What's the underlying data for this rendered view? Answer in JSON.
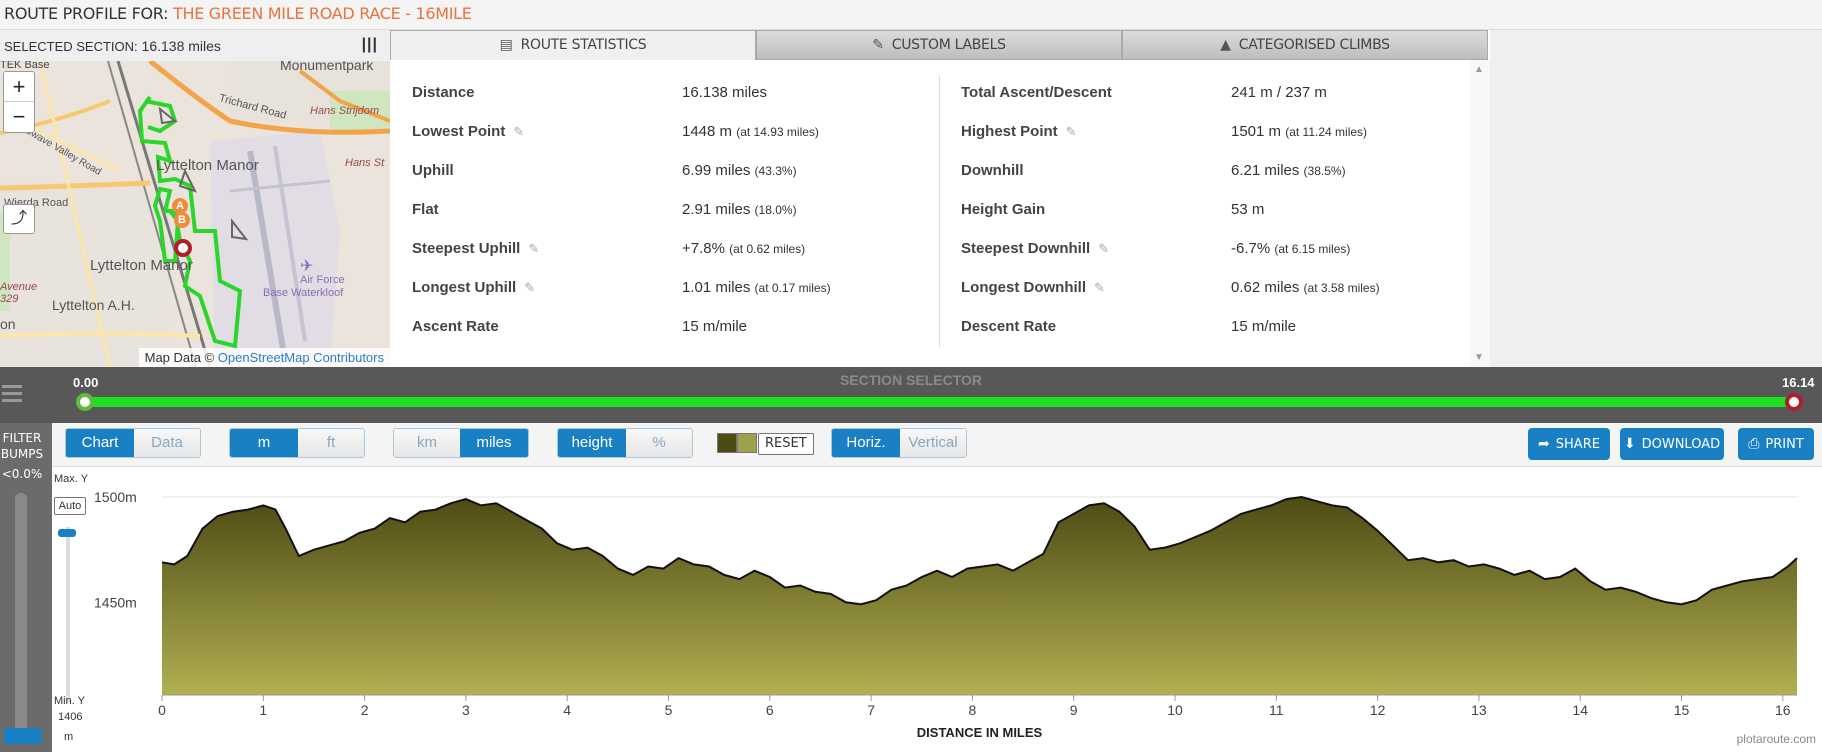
{
  "title": {
    "label": "ROUTE PROFILE FOR:",
    "route_name": "THE GREEN MILE ROAD RACE - 16MILE"
  },
  "map": {
    "selected_section_label": "SELECTED SECTION:",
    "selected_section_value": "16.138 miles",
    "labels": [
      "TEK Base",
      "Monumentpark",
      "Trichard Road",
      "Hans Strijdom",
      "Hans St",
      "Lyttelton Manor",
      "Wierda Road",
      "Lyttelton Manor",
      "Air Force",
      "Base Waterkloof",
      "Lyttelton A.H.",
      "Avenue",
      "329",
      "on",
      "Swave Valley Road"
    ],
    "zoom_in": "+",
    "zoom_out": "−",
    "markers": [
      "A",
      "B"
    ],
    "attribution_prefix": "Map Data ©",
    "attribution_link": "OpenStreetMap Contributors"
  },
  "tabs": [
    {
      "label": "ROUTE STATISTICS",
      "icon": "list-icon",
      "active": true
    },
    {
      "label": "CUSTOM LABELS",
      "icon": "pencil-icon",
      "active": false
    },
    {
      "label": "CATEGORISED CLIMBS",
      "icon": "mountain-icon",
      "active": false
    }
  ],
  "stats": {
    "left": [
      {
        "name": "Distance",
        "value": "16.138 miles",
        "extra": "",
        "editable": false
      },
      {
        "name": "Lowest Point",
        "value": "1448 m",
        "extra": "(at 14.93 miles)",
        "editable": true
      },
      {
        "name": "Uphill",
        "value": "6.99 miles",
        "extra": "(43.3%)",
        "editable": false
      },
      {
        "name": "Flat",
        "value": "2.91 miles",
        "extra": "(18.0%)",
        "editable": false
      },
      {
        "name": "Steepest Uphill",
        "value": "+7.8%",
        "extra": "(at 0.62 miles)",
        "editable": true
      },
      {
        "name": "Longest Uphill",
        "value": "1.01 miles",
        "extra": "(at 0.17 miles)",
        "editable": true
      },
      {
        "name": "Ascent Rate",
        "value": "15 m/mile",
        "extra": "",
        "editable": false
      }
    ],
    "right": [
      {
        "name": "Total Ascent/Descent",
        "value": "241 m / 237 m",
        "extra": "",
        "editable": false
      },
      {
        "name": "Highest Point",
        "value": "1501 m",
        "extra": "(at 11.24 miles)",
        "editable": true
      },
      {
        "name": "Downhill",
        "value": "6.21 miles",
        "extra": "(38.5%)",
        "editable": false
      },
      {
        "name": "Height Gain",
        "value": "53 m",
        "extra": "",
        "editable": false
      },
      {
        "name": "Steepest Downhill",
        "value": "-6.7%",
        "extra": "(at 6.15 miles)",
        "editable": true
      },
      {
        "name": "Longest Downhill",
        "value": "0.62 miles",
        "extra": "(at 3.58 miles)",
        "editable": true
      },
      {
        "name": "Descent Rate",
        "value": "15 m/mile",
        "extra": "",
        "editable": false
      }
    ]
  },
  "selector": {
    "caption": "SECTION SELECTOR",
    "start": "0.00",
    "end": "16.14",
    "track_color": "#1fe01f"
  },
  "filter": {
    "line1": "FILTER",
    "line2": "BUMPS",
    "value": "<0.0%"
  },
  "controls": {
    "chart_data_toggle": [
      "Chart",
      "Data"
    ],
    "units_height": [
      "m",
      "ft"
    ],
    "units_distance": [
      "km",
      "miles"
    ],
    "mode": [
      "height",
      "%"
    ],
    "reset": "RESET",
    "orientation": [
      "Horiz.",
      "Vertical"
    ],
    "share": "SHARE",
    "download": "DOWNLOAD",
    "print": "PRINT",
    "accent_color": "#1a80c4"
  },
  "yaxis_controls": {
    "max_label": "Max. Y",
    "auto": "Auto",
    "min_label": "Min. Y",
    "min_value": "1406",
    "min_unit": "m"
  },
  "credit": "plotaroute.com",
  "chart_data": {
    "type": "area",
    "title": "",
    "xlabel": "DISTANCE IN MILES",
    "ylabel": "",
    "xlim": [
      0,
      16.14
    ],
    "ylim": [
      1406,
      1500
    ],
    "x_ticks": [
      0,
      1,
      2,
      3,
      4,
      5,
      6,
      7,
      8,
      9,
      10,
      11,
      12,
      13,
      14,
      15,
      16
    ],
    "y_ticks": [
      {
        "value": 1500,
        "label": "1500m"
      },
      {
        "value": 1450,
        "label": "1450m"
      }
    ],
    "fill_top": "#4e4a14",
    "fill_bottom": "#b1b052",
    "series": [
      {
        "x": [
          0,
          0.12,
          0.25,
          0.4,
          0.55,
          0.7,
          0.85,
          1.0,
          1.12,
          1.22,
          1.35,
          1.5,
          1.65,
          1.8,
          1.95,
          2.1,
          2.25,
          2.4,
          2.55,
          2.7,
          2.85,
          3.0,
          3.15,
          3.3,
          3.45,
          3.6,
          3.75,
          3.9,
          4.05,
          4.2,
          4.35,
          4.5,
          4.65,
          4.8,
          4.95,
          5.1,
          5.25,
          5.4,
          5.55,
          5.7,
          5.85,
          6.0,
          6.15,
          6.3,
          6.45,
          6.6,
          6.75,
          6.9,
          7.05,
          7.2,
          7.35,
          7.5,
          7.65,
          7.8,
          7.95,
          8.1,
          8.25,
          8.4,
          8.55,
          8.7,
          8.85,
          9.0,
          9.15,
          9.3,
          9.45,
          9.6,
          9.75,
          9.9,
          10.05,
          10.2,
          10.35,
          10.5,
          10.65,
          10.8,
          10.95,
          11.1,
          11.25,
          11.4,
          11.55,
          11.7,
          11.85,
          12.0,
          12.15,
          12.3,
          12.45,
          12.6,
          12.75,
          12.9,
          13.05,
          13.2,
          13.35,
          13.5,
          13.65,
          13.8,
          13.95,
          14.1,
          14.25,
          14.4,
          14.55,
          14.7,
          14.85,
          15.0,
          15.15,
          15.3,
          15.45,
          15.6,
          15.75,
          15.9,
          16.05,
          16.14
        ],
        "y": [
          1469,
          1468,
          1472,
          1485,
          1491,
          1493,
          1494,
          1496,
          1494,
          1485,
          1472,
          1475,
          1477,
          1479,
          1483,
          1485,
          1490,
          1488,
          1493,
          1494,
          1497,
          1499,
          1496,
          1497,
          1493,
          1489,
          1485,
          1478,
          1475,
          1476,
          1472,
          1466,
          1463,
          1467,
          1466,
          1471,
          1468,
          1467,
          1463,
          1461,
          1465,
          1462,
          1457,
          1458,
          1455,
          1454,
          1450,
          1449,
          1451,
          1456,
          1458,
          1462,
          1465,
          1462,
          1466,
          1467,
          1468,
          1465,
          1469,
          1473,
          1488,
          1492,
          1496,
          1497,
          1493,
          1486,
          1475,
          1476,
          1478,
          1481,
          1484,
          1488,
          1492,
          1494,
          1496,
          1499,
          1500,
          1498,
          1496,
          1495,
          1490,
          1484,
          1477,
          1470,
          1471,
          1469,
          1470,
          1467,
          1468,
          1466,
          1463,
          1465,
          1461,
          1462,
          1466,
          1460,
          1456,
          1457,
          1455,
          1452,
          1450,
          1449,
          1451,
          1456,
          1458,
          1460,
          1461,
          1462,
          1467,
          1471
        ]
      }
    ]
  }
}
